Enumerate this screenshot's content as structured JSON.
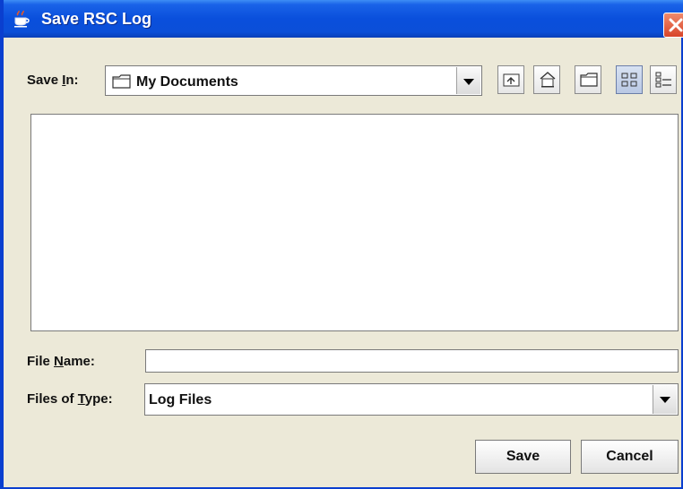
{
  "window": {
    "title": "Save RSC Log"
  },
  "save_in": {
    "label_before": "Save ",
    "label_mnemonic": "I",
    "label_after": "n:",
    "value": "My Documents"
  },
  "file_name": {
    "label_before": "File ",
    "label_mnemonic": "N",
    "label_after": "ame:",
    "value": ""
  },
  "file_type": {
    "label_before": "Files of ",
    "label_mnemonic": "T",
    "label_after": "ype:",
    "value": "Log Files"
  },
  "buttons": {
    "save": "Save",
    "cancel": "Cancel"
  },
  "toolbar_icons": [
    "up-folder-icon",
    "home-icon",
    "new-folder-icon",
    "list-view-icon",
    "details-view-icon"
  ],
  "colors": {
    "titlebar": "#0a4fdc",
    "background": "#ece9d8",
    "close": "#d8452a"
  }
}
